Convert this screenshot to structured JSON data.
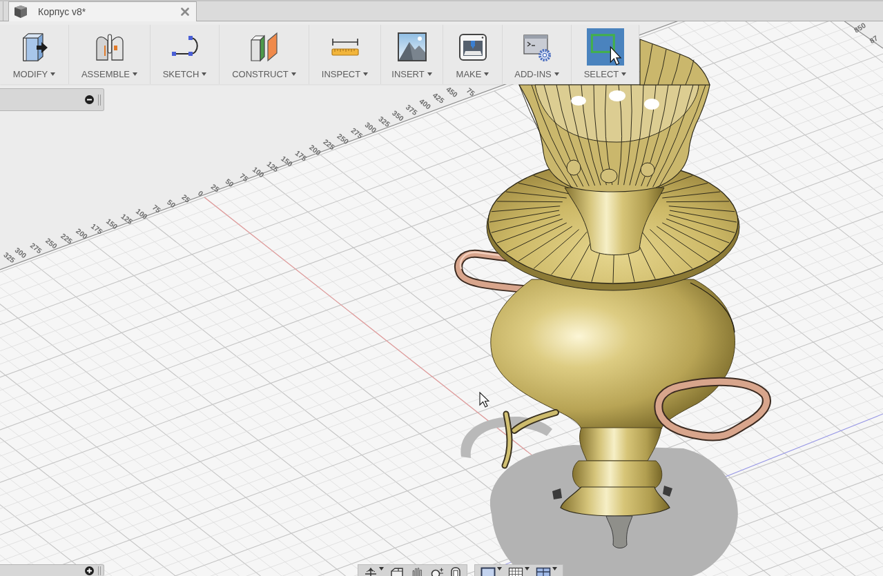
{
  "document_tab": {
    "title": "Корпус v8*"
  },
  "toolbar": {
    "menus": [
      {
        "label": "MODIFY",
        "selected": false
      },
      {
        "label": "ASSEMBLE",
        "selected": false
      },
      {
        "label": "SKETCH",
        "selected": false
      },
      {
        "label": "CONSTRUCT",
        "selected": false
      },
      {
        "label": "INSPECT",
        "selected": false
      },
      {
        "label": "INSERT",
        "selected": false
      },
      {
        "label": "MAKE",
        "selected": false
      },
      {
        "label": "ADD-INS",
        "selected": false
      },
      {
        "label": "SELECT",
        "selected": true
      }
    ]
  },
  "viewport": {
    "ruler_labels": [
      "325",
      "300",
      "275",
      "250",
      "225",
      "200",
      "175",
      "150",
      "125",
      "100",
      "75",
      "50",
      "25",
      "0",
      "25",
      "50",
      "75",
      "100",
      "125",
      "150",
      "175",
      "200",
      "225",
      "250",
      "275",
      "300",
      "325",
      "350",
      "375",
      "400",
      "425",
      "450",
      "75"
    ],
    "edge_ruler_labels": [
      "850",
      "87"
    ]
  }
}
